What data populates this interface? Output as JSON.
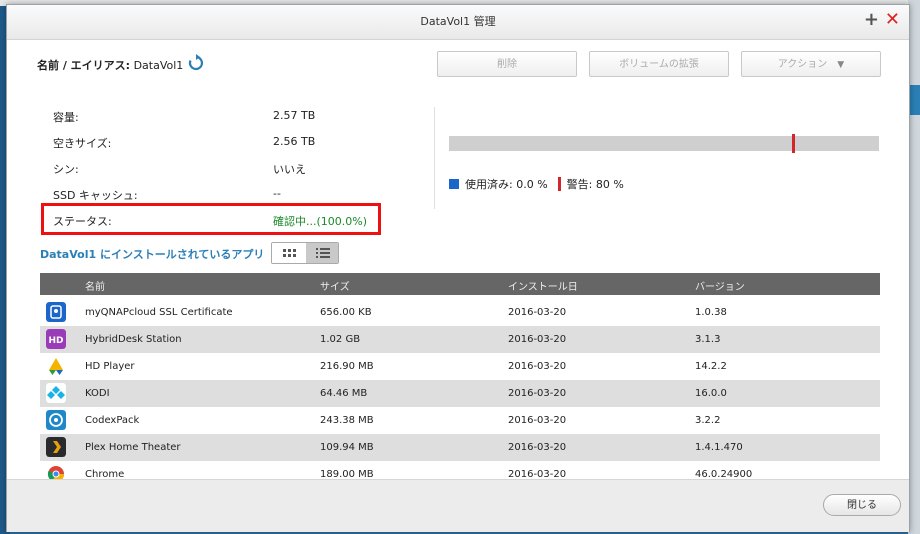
{
  "window": {
    "title": "DataVol1 管理"
  },
  "namebar": {
    "label": "名前 / エイリアス:",
    "value": "DataVol1"
  },
  "toolbar": {
    "delete_label": "削除",
    "expand_label": "ボリュームの拡張",
    "action_label": "アクション"
  },
  "info": [
    {
      "label": "容量:",
      "value": "2.57 TB"
    },
    {
      "label": "空きサイズ:",
      "value": "2.56 TB"
    },
    {
      "label": "シン:",
      "value": "いいえ"
    },
    {
      "label": "SSD キャッシュ:",
      "value": "--"
    },
    {
      "label": "ステータス:",
      "value": "確認中...(100.0%)"
    }
  ],
  "usage": {
    "used_percent": 0.0,
    "warning_percent": 80,
    "used_label": "使用済み: 0.0 %",
    "warning_label": "警告: 80 %"
  },
  "apps": {
    "title": "DataVol1 にインストールされているアプリ",
    "columns": [
      "名前",
      "サイズ",
      "インストール日",
      "バージョン"
    ],
    "rows": [
      {
        "name": "myQNAPcloud SSL Certificate",
        "size": "656.00 KB",
        "date": "2016-03-20",
        "version": "1.0.38",
        "icon": "ssl-certificate-icon"
      },
      {
        "name": "HybridDesk Station",
        "size": "1.02 GB",
        "date": "2016-03-20",
        "version": "3.1.3",
        "icon": "hybriddesk-icon"
      },
      {
        "name": "HD Player",
        "size": "216.90 MB",
        "date": "2016-03-20",
        "version": "14.2.2",
        "icon": "hd-player-icon"
      },
      {
        "name": "KODI",
        "size": "64.46 MB",
        "date": "2016-03-20",
        "version": "16.0.0",
        "icon": "kodi-icon"
      },
      {
        "name": "CodexPack",
        "size": "243.38 MB",
        "date": "2016-03-20",
        "version": "3.2.2",
        "icon": "codexpack-icon"
      },
      {
        "name": "Plex Home Theater",
        "size": "109.94 MB",
        "date": "2016-03-20",
        "version": "1.4.1.470",
        "icon": "plex-icon"
      },
      {
        "name": "Chrome",
        "size": "189.00 MB",
        "date": "2016-03-20",
        "version": "46.0.24900",
        "icon": "chrome-icon"
      }
    ]
  },
  "footer": {
    "close_label": "閉じる"
  },
  "colors": {
    "accent": "#2a7fb6",
    "used": "#1b66c9",
    "warning": "#d3262b",
    "status_ok": "#1a8a2a",
    "highlight": "#e11111"
  }
}
